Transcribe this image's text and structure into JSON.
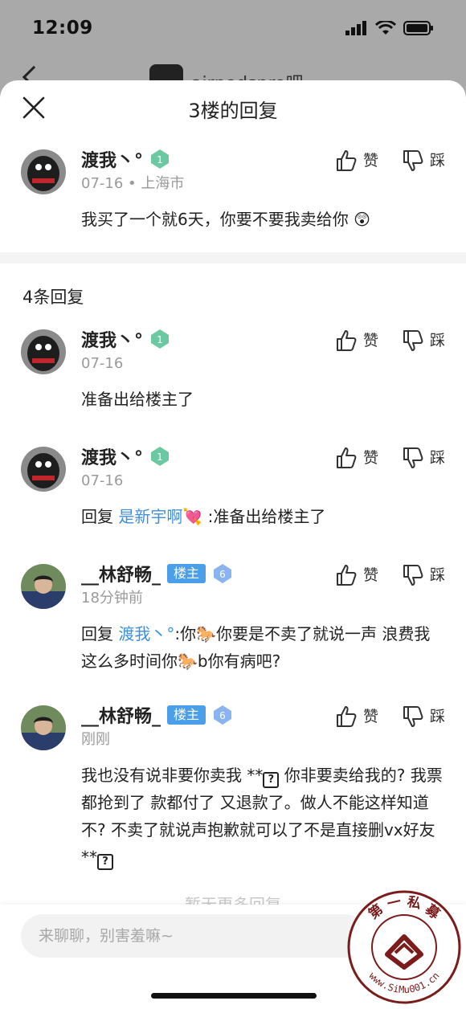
{
  "status_bar": {
    "time": "12:09"
  },
  "background": {
    "title": "airpodspro吧"
  },
  "sheet": {
    "title": "3楼的回复",
    "reply_count": "4条回复",
    "no_more": "暂无更多回复"
  },
  "main_comment": {
    "name": "渡我丶°",
    "level": "1",
    "meta": "07-16 • 上海市",
    "text": "我买了一个就6天，你要不要我卖给你 😲",
    "like_label": "赞",
    "dislike_label": "踩"
  },
  "replies": [
    {
      "name": "渡我丶°",
      "level": "1",
      "meta": "07-16",
      "text": "准备出给楼主了",
      "like_label": "赞",
      "dislike_label": "踩"
    },
    {
      "name": "渡我丶°",
      "level": "1",
      "meta": "07-16",
      "reply_prefix": "回复 ",
      "reply_to": "是新宇啊💘",
      "text": " :准备出给楼主了",
      "like_label": "赞",
      "dislike_label": "踩"
    },
    {
      "name": "__林舒畅_",
      "badge": "楼主",
      "level": "6",
      "meta": "18分钟前",
      "reply_prefix": "回复 ",
      "reply_to": "渡我丶°",
      "text": ":你🐎你要是不卖了就说一声 浪费我这么多时间你🐎b你有病吧?",
      "like_label": "赞",
      "dislike_label": "踩"
    },
    {
      "name": "__林舒畅_",
      "badge": "楼主",
      "level": "6",
      "meta": "刚刚",
      "text_parts": [
        "我也没有说非要你卖我 **",
        " 你非要卖给我的? 我票都抢到了 款都付了 又退款了。做人不能这样知道不? 不卖了就说声抱歉就可以了不是直接删vx好友 **"
      ],
      "qmark": "?",
      "like_label": "赞",
      "dislike_label": "踩"
    }
  ],
  "input": {
    "placeholder": "来聊聊，别害羞嘛~"
  },
  "watermark": {
    "top_text": "第 一 私 募",
    "bottom_text": "www.SiMu001.cn"
  },
  "colors": {
    "accent": "#3b8fe0",
    "badge": "#4a9fe8",
    "gem": "#6cc8a0",
    "level6": "#8ab4f0"
  },
  "icons": [
    "close-icon",
    "thumbs-up-icon",
    "thumbs-down-icon",
    "gem-level-icon",
    "signal-icon",
    "wifi-icon",
    "battery-icon"
  ]
}
